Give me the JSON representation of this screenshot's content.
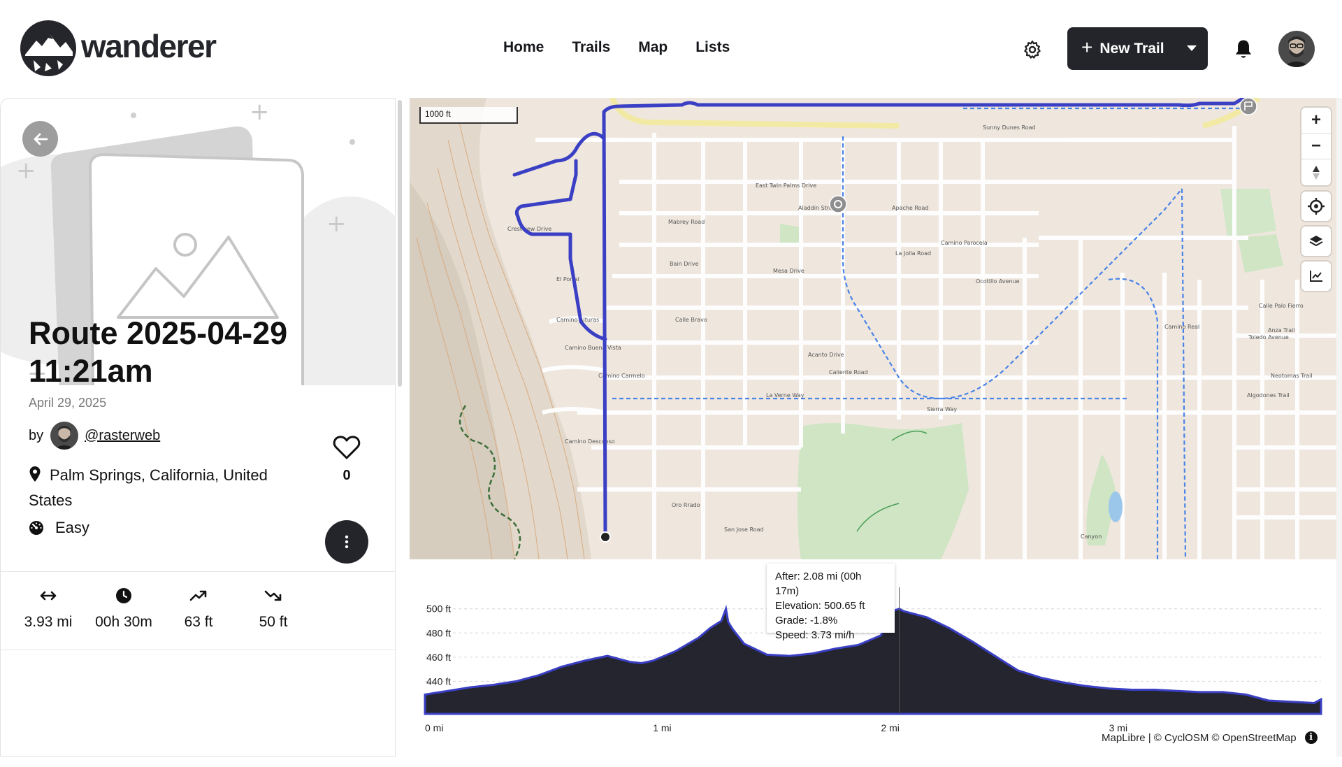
{
  "brand": {
    "name": "wanderer"
  },
  "nav": [
    {
      "label": "Home"
    },
    {
      "label": "Trails"
    },
    {
      "label": "Map"
    },
    {
      "label": "Lists"
    }
  ],
  "header": {
    "new_trail_label": "New Trail",
    "icons": [
      "gear-icon",
      "bell-icon",
      "user-avatar"
    ]
  },
  "trail": {
    "title": "Route 2025-04-29 11:21am",
    "date": "April 29, 2025",
    "by_label": "by",
    "author": "@rasterweb",
    "location": "Palm Springs, California, United States",
    "difficulty": "Easy",
    "likes": "0"
  },
  "stats": [
    {
      "icon": "distance-icon",
      "value": "3.93 mi"
    },
    {
      "icon": "clock-icon",
      "value": "00h 30m"
    },
    {
      "icon": "elevation-gain-icon",
      "value": "63 ft"
    },
    {
      "icon": "elevation-loss-icon",
      "value": "50 ft"
    }
  ],
  "map": {
    "scale_label": "1000 ft",
    "attribution": "MapLibre | © CyclOSM © OpenStreetMap",
    "route_color": "#3a3fc4",
    "street_labels": [
      "East Twin Palms Drive",
      "Apache Road",
      "La Jolla Road",
      "Mesa Drive",
      "Calle Bravo",
      "Camino Alturas",
      "Camino Buena Vista",
      "Camino Carmelo",
      "Camino Descanso",
      "La Verne Way",
      "Sierra Way",
      "Camino Real",
      "Toledo Avenue",
      "Anza Trail",
      "Neotomas Trail",
      "Algodones Trail",
      "Oro Rrado",
      "San Jose Road",
      "El Portal",
      "Crestview Drive",
      "Mabrey Road",
      "Bain Drive",
      "Caliente Road",
      "Canyon",
      "Calle Palo Fierro",
      "Aladdin Street",
      "Ocotillo Avenue",
      "Sunny Dunes Road",
      "Camino Parocela",
      "Acanto Drive"
    ]
  },
  "chart_data": {
    "type": "area",
    "title": "",
    "xlabel": "",
    "ylabel": "",
    "x_unit": "mi",
    "y_unit": "ft",
    "xlim": [
      0,
      3.93
    ],
    "ylim": [
      413,
      512
    ],
    "x_ticks": [
      "0 mi",
      "1 mi",
      "2 mi",
      "3 mi"
    ],
    "y_ticks": [
      "440 ft",
      "460 ft",
      "480 ft",
      "500 ft"
    ],
    "series": [
      {
        "x": [
          0,
          0.1,
          0.2,
          0.3,
          0.4,
          0.5,
          0.6,
          0.7,
          0.8,
          0.9,
          0.95,
          1.0,
          1.1,
          1.2,
          1.25,
          1.3,
          1.32,
          1.33,
          1.35,
          1.4,
          1.5,
          1.6,
          1.7,
          1.8,
          1.9,
          2.0,
          2.05,
          2.08,
          2.1,
          2.2,
          2.3,
          2.4,
          2.5,
          2.6,
          2.7,
          2.8,
          2.9,
          3.0,
          3.1,
          3.2,
          3.3,
          3.4,
          3.5,
          3.6,
          3.7,
          3.8,
          3.9,
          3.93
        ],
        "y": [
          429,
          432,
          435,
          437,
          440,
          445,
          452,
          457,
          461,
          456,
          455,
          457,
          465,
          476,
          484,
          490,
          500,
          489,
          483,
          471,
          462,
          461,
          463,
          467,
          470,
          478,
          498,
          500,
          498,
          493,
          484,
          473,
          461,
          449,
          443,
          439,
          436,
          434,
          433,
          433,
          432,
          431,
          431,
          429,
          424,
          423,
          422,
          425
        ]
      }
    ],
    "tooltip": {
      "after": "After: 2.08 mi (00h 17m)",
      "elevation": "Elevation: 500.65 ft",
      "grade": "Grade: -1.8%",
      "speed": "Speed: 3.73 mi/h"
    }
  }
}
